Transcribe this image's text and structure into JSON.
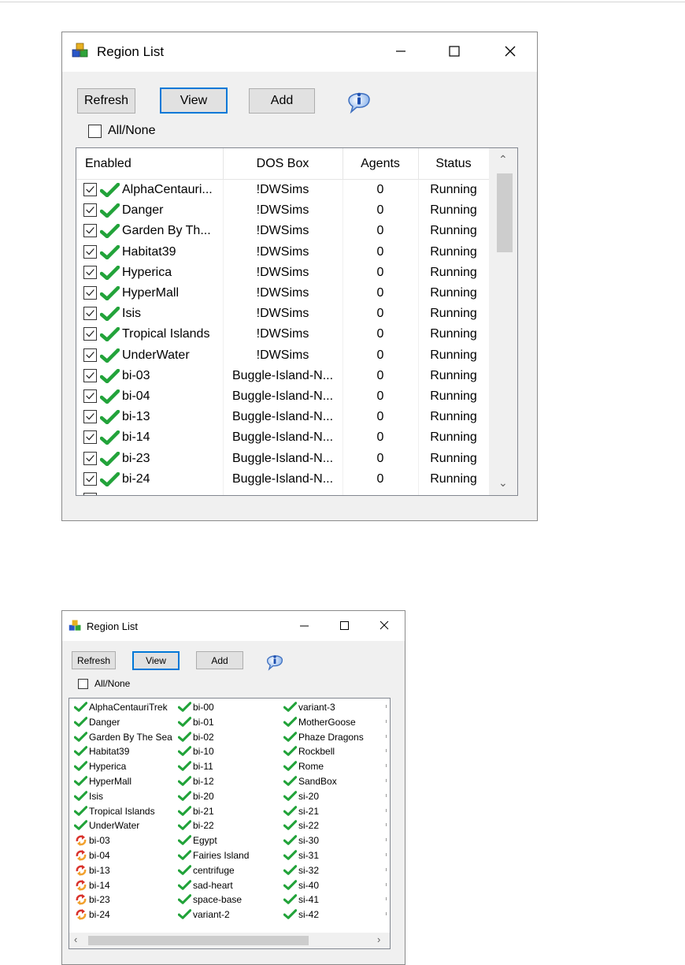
{
  "windows": [
    {
      "title": "Region List",
      "buttons": {
        "refresh": "Refresh",
        "view": "View",
        "add": "Add"
      },
      "all_none_label": "All/None",
      "columns": [
        "Enabled",
        "DOS Box",
        "Agents",
        "Status"
      ],
      "rows": [
        {
          "name": "AlphaCentauri...",
          "dos": "!DWSims",
          "agents": "0",
          "status": "Running"
        },
        {
          "name": "Danger",
          "dos": "!DWSims",
          "agents": "0",
          "status": "Running"
        },
        {
          "name": "Garden By Th...",
          "dos": "!DWSims",
          "agents": "0",
          "status": "Running"
        },
        {
          "name": "Habitat39",
          "dos": "!DWSims",
          "agents": "0",
          "status": "Running"
        },
        {
          "name": "Hyperica",
          "dos": "!DWSims",
          "agents": "0",
          "status": "Running"
        },
        {
          "name": "HyperMall",
          "dos": "!DWSims",
          "agents": "0",
          "status": "Running"
        },
        {
          "name": "Isis",
          "dos": "!DWSims",
          "agents": "0",
          "status": "Running"
        },
        {
          "name": "Tropical Islands",
          "dos": "!DWSims",
          "agents": "0",
          "status": "Running"
        },
        {
          "name": "UnderWater",
          "dos": "!DWSims",
          "agents": "0",
          "status": "Running"
        },
        {
          "name": "bi-03",
          "dos": "Buggle-Island-N...",
          "agents": "0",
          "status": "Running"
        },
        {
          "name": "bi-04",
          "dos": "Buggle-Island-N...",
          "agents": "0",
          "status": "Running"
        },
        {
          "name": "bi-13",
          "dos": "Buggle-Island-N...",
          "agents": "0",
          "status": "Running"
        },
        {
          "name": "bi-14",
          "dos": "Buggle-Island-N...",
          "agents": "0",
          "status": "Running"
        },
        {
          "name": "bi-23",
          "dos": "Buggle-Island-N...",
          "agents": "0",
          "status": "Running"
        },
        {
          "name": "bi-24",
          "dos": "Buggle-Island-N...",
          "agents": "0",
          "status": "Running"
        }
      ]
    },
    {
      "title": "Region List",
      "buttons": {
        "refresh": "Refresh",
        "view": "View",
        "add": "Add"
      },
      "all_none_label": "All/None",
      "list_columns": [
        [
          {
            "label": "AlphaCentauriTrek",
            "icon": "check-icon"
          },
          {
            "label": "Danger",
            "icon": "check-icon"
          },
          {
            "label": "Garden By The Sea",
            "icon": "check-icon"
          },
          {
            "label": "Habitat39",
            "icon": "check-icon"
          },
          {
            "label": "Hyperica",
            "icon": "check-icon"
          },
          {
            "label": "HyperMall",
            "icon": "check-icon"
          },
          {
            "label": "Isis",
            "icon": "check-icon"
          },
          {
            "label": "Tropical Islands",
            "icon": "check-icon"
          },
          {
            "label": "UnderWater",
            "icon": "check-icon"
          },
          {
            "label": "bi-03",
            "icon": "cycle-icon"
          },
          {
            "label": "bi-04",
            "icon": "cycle-icon"
          },
          {
            "label": "bi-13",
            "icon": "cycle-icon"
          },
          {
            "label": "bi-14",
            "icon": "cycle-icon"
          },
          {
            "label": "bi-23",
            "icon": "cycle-icon"
          },
          {
            "label": "bi-24",
            "icon": "cycle-icon"
          }
        ],
        [
          {
            "label": "bi-00",
            "icon": "check-icon"
          },
          {
            "label": "bi-01",
            "icon": "check-icon"
          },
          {
            "label": "bi-02",
            "icon": "check-icon"
          },
          {
            "label": "bi-10",
            "icon": "check-icon"
          },
          {
            "label": "bi-11",
            "icon": "check-icon"
          },
          {
            "label": "bi-12",
            "icon": "check-icon"
          },
          {
            "label": "bi-20",
            "icon": "check-icon"
          },
          {
            "label": "bi-21",
            "icon": "check-icon"
          },
          {
            "label": "bi-22",
            "icon": "check-icon"
          },
          {
            "label": "Egypt",
            "icon": "check-icon"
          },
          {
            "label": "Fairies Island",
            "icon": "check-icon"
          },
          {
            "label": "centrifuge",
            "icon": "check-icon"
          },
          {
            "label": "sad-heart",
            "icon": "check-icon"
          },
          {
            "label": "space-base",
            "icon": "check-icon"
          },
          {
            "label": "variant-2",
            "icon": "check-icon"
          }
        ],
        [
          {
            "label": "variant-3",
            "icon": "check-icon"
          },
          {
            "label": "MotherGoose",
            "icon": "check-icon"
          },
          {
            "label": "Phaze Dragons",
            "icon": "check-icon"
          },
          {
            "label": "Rockbell",
            "icon": "check-icon"
          },
          {
            "label": "Rome",
            "icon": "check-icon"
          },
          {
            "label": "SandBox",
            "icon": "check-icon"
          },
          {
            "label": "si-20",
            "icon": "check-icon"
          },
          {
            "label": "si-21",
            "icon": "check-icon"
          },
          {
            "label": "si-22",
            "icon": "check-icon"
          },
          {
            "label": "si-30",
            "icon": "check-icon"
          },
          {
            "label": "si-31",
            "icon": "check-icon"
          },
          {
            "label": "si-32",
            "icon": "check-icon"
          },
          {
            "label": "si-40",
            "icon": "check-icon"
          },
          {
            "label": "si-41",
            "icon": "check-icon"
          },
          {
            "label": "si-42",
            "icon": "check-icon"
          }
        ]
      ]
    }
  ],
  "colors": {
    "check_green": "#22a33a",
    "active_border": "#0078d7",
    "cycle_red": "#d9322b",
    "cycle_orange": "#f2a12e"
  }
}
